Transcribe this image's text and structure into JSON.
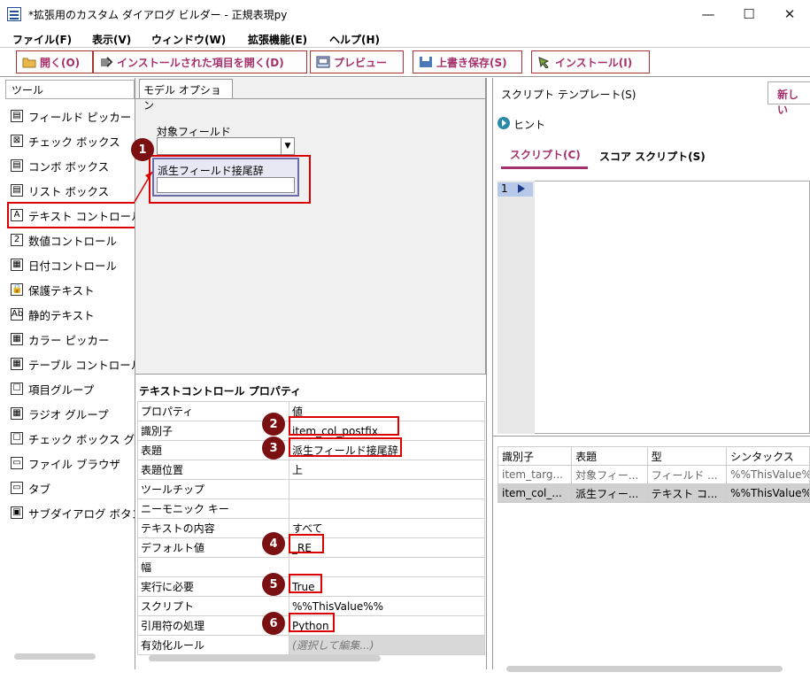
{
  "window": {
    "title": "*拡張用のカスタム ダイアログ ビルダー - 正規表現py",
    "minimize": "—",
    "maximize": "☐",
    "close": "✕"
  },
  "menu": [
    "ファイル(F)",
    "表示(V)",
    "ウィンドウ(W)",
    "拡張機能(E)",
    "ヘルプ(H)"
  ],
  "toolbar": [
    {
      "label": "開く(O)",
      "icon": "folder-icon"
    },
    {
      "label": "インストールされた項目を開く(D)",
      "icon": "install-open-icon"
    },
    {
      "label": "プレビュー",
      "icon": "preview-icon"
    },
    {
      "label": "上書き保存(S)",
      "icon": "save-icon"
    },
    {
      "label": "インストール(I)",
      "icon": "install-icon"
    }
  ],
  "tools": {
    "header": "ツール",
    "items": [
      "フィールド ピッカー",
      "チェック ボックス",
      "コンボ ボックス",
      "リスト ボックス",
      "テキスト コントロール",
      "数値コントロール",
      "日付コントロール",
      "保護テキスト",
      "静的テキスト",
      "カラー ピッカー",
      "テーブル コントロール",
      "項目グループ",
      "ラジオ グループ",
      "チェック ボックス グループ",
      "ファイル ブラウザ",
      "タブ",
      "サブダイアログ ボタン"
    ]
  },
  "canvas": {
    "tab": "モデル オプション",
    "target_label": "対象フィールド",
    "suffix_label": "派生フィールド接尾辞",
    "dropdown_arrow": "▼"
  },
  "properties": {
    "title": "テキストコントロール プロパティ",
    "header": [
      "プロパティ",
      "値"
    ],
    "rows": [
      [
        "識別子",
        "item_col_postfix"
      ],
      [
        "表題",
        "派生フィールド接尾辞"
      ],
      [
        "表題位置",
        "上"
      ],
      [
        "ツールチップ",
        ""
      ],
      [
        "ニーモニック キー",
        ""
      ],
      [
        "テキストの内容",
        "すべて"
      ],
      [
        "デフォルト値",
        "_RE"
      ],
      [
        "幅",
        ""
      ],
      [
        "実行に必要",
        "True"
      ],
      [
        "スクリプト",
        "%%ThisValue%%"
      ],
      [
        "引用符の処理",
        "Python"
      ],
      [
        "有効化ルール",
        "(選択して編集...)"
      ]
    ]
  },
  "badges": [
    "1",
    "2",
    "3",
    "4",
    "5",
    "6"
  ],
  "script": {
    "template_label": "スクリプト テンプレート(S)",
    "new_button": "新しい",
    "hint": "ヒント",
    "tabs": [
      "スクリプト(C)",
      "スコア スクリプト(S)"
    ],
    "line_number": "1"
  },
  "controls_table": {
    "header": [
      "識別子",
      "表題",
      "型",
      "シンタックス"
    ],
    "rows": [
      [
        "item_targ...",
        "対象フィー...",
        "フィールド ...",
        "%%ThisValue%%"
      ],
      [
        "item_col_...",
        "派生フィー...",
        "テキスト コ...",
        "%%ThisValue%%"
      ]
    ]
  },
  "colors": {
    "accent": "#a6306b",
    "red": "#d00000",
    "badge": "#7a1012"
  }
}
